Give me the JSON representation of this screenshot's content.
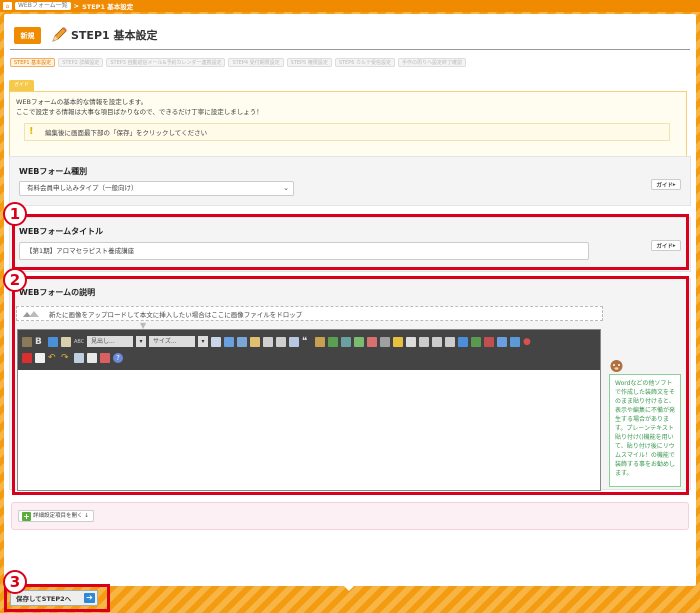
{
  "breadcrumb": {
    "home_icon": "home-icon",
    "link": "WEBフォーム一覧",
    "sep": ">",
    "current": "STEP1 基本設定"
  },
  "header": {
    "badge": "新規",
    "title": "STEP1 基本設定"
  },
  "steps": [
    "STEP1 基本設定",
    "STEP2 詳細設定",
    "STEP3 自動返信メール&予約カレンダー連携設定",
    "STEP4 受付期限設定",
    "STEP5 権限設定",
    "STEP6 カルテ受信設定",
    "手作の周りへ設定終了確認"
  ],
  "guide": {
    "tab": "ガイド",
    "line1": "WEBフォームの基本的な情報を設定します。",
    "line2": "ここで設定する情報は大事な項目ばかりなので、できるだけ丁寧に設定しましょう！",
    "note": "編集後に画面最下部の「保存」をクリックしてください"
  },
  "form_type": {
    "label": "WEBフォーム種別",
    "value": "有料会員申し込みタイプ（一般向け）",
    "guide_btn": "ガイド"
  },
  "form_title": {
    "label": "WEBフォームタイトル",
    "value": "【第1期】アロマセラピスト養成講座",
    "guide_btn": "ガイド"
  },
  "form_desc": {
    "label": "WEBフォームの説明",
    "drop_text": "新たに画像をアップロードして本文に挿入したい場合はここに画像ファイルをドロップ",
    "toolbar": {
      "heading_select": "見出し...",
      "size_select": "サイズ..."
    },
    "tip": "Wordなどの他ソフトで作成した装飾文をそのまま貼り付けると、表示や編集に不備が発生する場合があります。プレーンテキスト貼り付け()機能を用いて、貼り付け後にリウムスマイル！の機能で装飾する事をお勧めします。"
  },
  "detail_btn": "詳細設定項目を開く",
  "save_btn": "保存してSTEP2へ",
  "annotations": [
    "1",
    "2",
    "3"
  ],
  "colors": {
    "accent": "#f08a00",
    "marker": "#d9001b",
    "tip_green": "#3a9a4e"
  }
}
